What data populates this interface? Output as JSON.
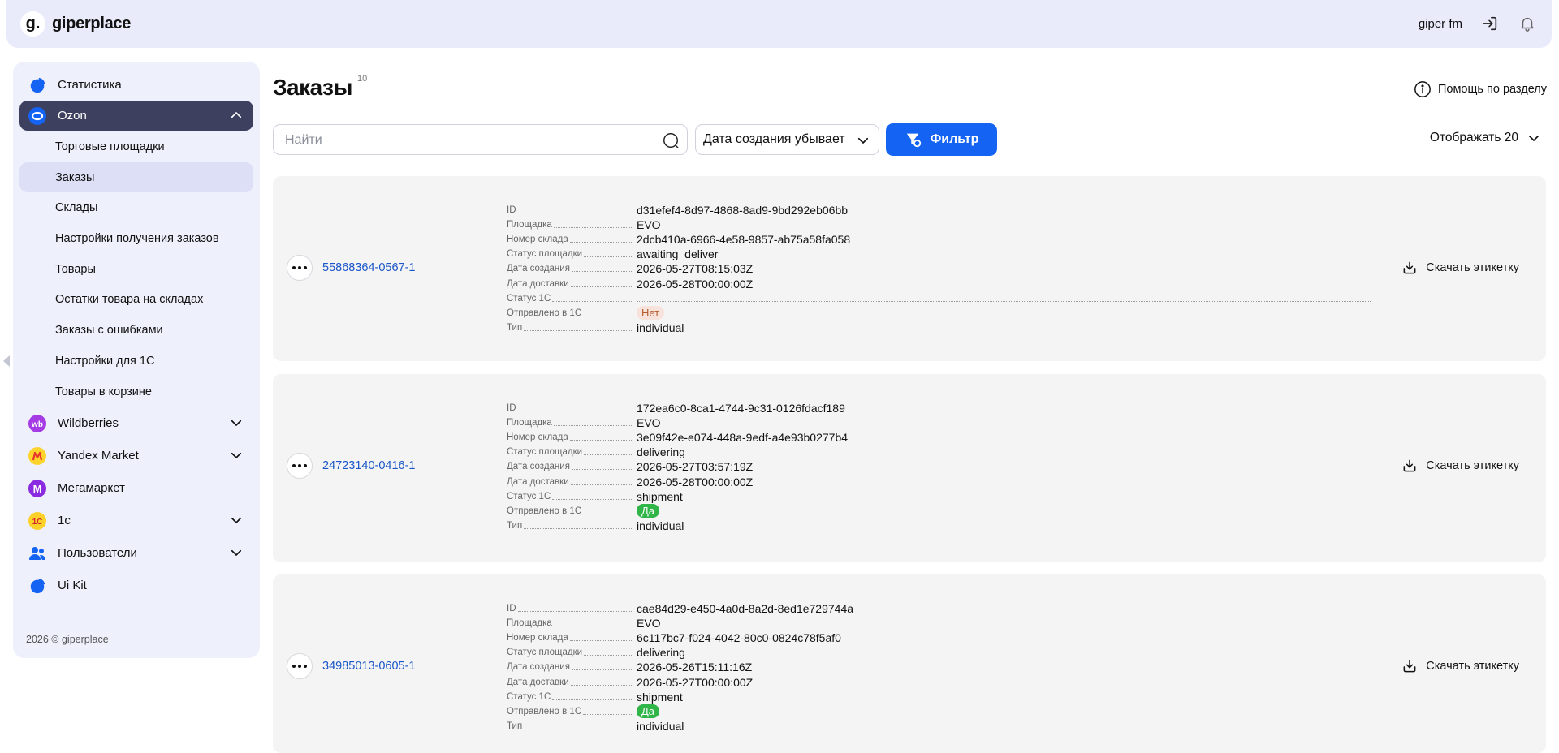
{
  "header": {
    "logo_mark": "g.",
    "app_name": "giperplace",
    "user_name": "giper fm"
  },
  "sidebar": {
    "items": [
      {
        "label": "Статистика"
      },
      {
        "label": "Ozon"
      },
      {
        "label": "Wildberries"
      },
      {
        "label": "Yandex Market"
      },
      {
        "label": "Мегамаркет"
      },
      {
        "label": "1с"
      },
      {
        "label": "Пользователи"
      },
      {
        "label": "Ui Kit"
      }
    ],
    "ozon_sub": [
      {
        "label": "Торговые площадки"
      },
      {
        "label": "Заказы"
      },
      {
        "label": "Склады"
      },
      {
        "label": "Настройки получения заказов"
      },
      {
        "label": "Товары"
      },
      {
        "label": "Остатки товара на складах"
      },
      {
        "label": "Заказы с ошибками"
      },
      {
        "label": "Настройки для 1С"
      },
      {
        "label": "Товары в корзине"
      }
    ],
    "wb_icon_text": "wb",
    "megamarket_icon_text": "M",
    "onec_icon_text": "1С",
    "footer": "2026 © giperplace"
  },
  "main": {
    "title": "Заказы",
    "count": "10",
    "help_label": "Помощь по разделу",
    "search_placeholder": "Найти",
    "sort_label": "Дата создания убывает",
    "filter_label": "Фильтр",
    "per_page_label": "Отображать 20"
  },
  "field_labels": {
    "id": "ID",
    "platform": "Площадка",
    "warehouse": "Номер склада",
    "platform_status": "Статус площадки",
    "created": "Дата создания",
    "delivery": "Дата доставки",
    "status_1c": "Статус 1С",
    "sent_1c": "Отправлено в 1С",
    "type": "Тип"
  },
  "download_label": "Скачать этикетку",
  "orders": [
    {
      "number": "55868364-0567-1",
      "id": "d31efef4-8d97-4868-8ad9-9bd292eb06bb",
      "platform": "EVO",
      "warehouse": "2dcb410a-6966-4e58-9857-ab75a58fa058",
      "platform_status": "awaiting_deliver",
      "created": "2026-05-27T08:15:03Z",
      "delivery": "2026-05-28T00:00:00Z",
      "status_1c": "",
      "sent_1c": "Нет",
      "type": "individual"
    },
    {
      "number": "24723140-0416-1",
      "id": "172ea6c0-8ca1-4744-9c31-0126fdacf189",
      "platform": "EVO",
      "warehouse": "3e09f42e-e074-448a-9edf-a4e93b0277b4",
      "platform_status": "delivering",
      "created": "2026-05-27T03:57:19Z",
      "delivery": "2026-05-28T00:00:00Z",
      "status_1c": "shipment",
      "sent_1c": "Да",
      "type": "individual"
    },
    {
      "number": "34985013-0605-1",
      "id": "cae84d29-e450-4a0d-8a2d-8ed1e729744a",
      "platform": "EVO",
      "warehouse": "6c117bc7-f024-4042-80c0-0824c78f5af0",
      "platform_status": "delivering",
      "created": "2026-05-26T15:11:16Z",
      "delivery": "2026-05-27T00:00:00Z",
      "status_1c": "shipment",
      "sent_1c": "Да",
      "type": "individual"
    }
  ]
}
